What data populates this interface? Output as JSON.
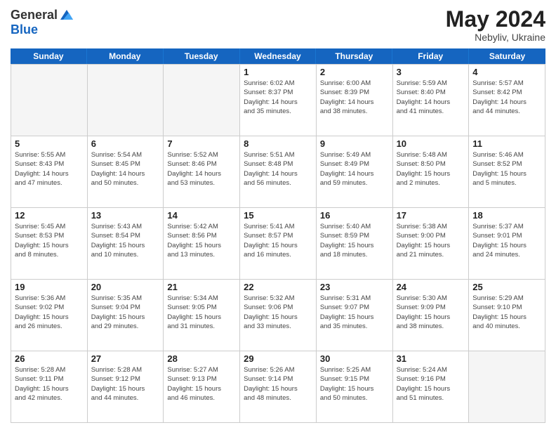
{
  "header": {
    "logo_general": "General",
    "logo_blue": "Blue",
    "month_year": "May 2024",
    "location": "Nebyliv, Ukraine"
  },
  "weekdays": [
    "Sunday",
    "Monday",
    "Tuesday",
    "Wednesday",
    "Thursday",
    "Friday",
    "Saturday"
  ],
  "weeks": [
    [
      {
        "day": "",
        "lines": [],
        "empty": true
      },
      {
        "day": "",
        "lines": [],
        "empty": true
      },
      {
        "day": "",
        "lines": [],
        "empty": true
      },
      {
        "day": "1",
        "lines": [
          "Sunrise: 6:02 AM",
          "Sunset: 8:37 PM",
          "Daylight: 14 hours",
          "and 35 minutes."
        ],
        "empty": false
      },
      {
        "day": "2",
        "lines": [
          "Sunrise: 6:00 AM",
          "Sunset: 8:39 PM",
          "Daylight: 14 hours",
          "and 38 minutes."
        ],
        "empty": false
      },
      {
        "day": "3",
        "lines": [
          "Sunrise: 5:59 AM",
          "Sunset: 8:40 PM",
          "Daylight: 14 hours",
          "and 41 minutes."
        ],
        "empty": false
      },
      {
        "day": "4",
        "lines": [
          "Sunrise: 5:57 AM",
          "Sunset: 8:42 PM",
          "Daylight: 14 hours",
          "and 44 minutes."
        ],
        "empty": false
      }
    ],
    [
      {
        "day": "5",
        "lines": [
          "Sunrise: 5:55 AM",
          "Sunset: 8:43 PM",
          "Daylight: 14 hours",
          "and 47 minutes."
        ],
        "empty": false
      },
      {
        "day": "6",
        "lines": [
          "Sunrise: 5:54 AM",
          "Sunset: 8:45 PM",
          "Daylight: 14 hours",
          "and 50 minutes."
        ],
        "empty": false
      },
      {
        "day": "7",
        "lines": [
          "Sunrise: 5:52 AM",
          "Sunset: 8:46 PM",
          "Daylight: 14 hours",
          "and 53 minutes."
        ],
        "empty": false
      },
      {
        "day": "8",
        "lines": [
          "Sunrise: 5:51 AM",
          "Sunset: 8:48 PM",
          "Daylight: 14 hours",
          "and 56 minutes."
        ],
        "empty": false
      },
      {
        "day": "9",
        "lines": [
          "Sunrise: 5:49 AM",
          "Sunset: 8:49 PM",
          "Daylight: 14 hours",
          "and 59 minutes."
        ],
        "empty": false
      },
      {
        "day": "10",
        "lines": [
          "Sunrise: 5:48 AM",
          "Sunset: 8:50 PM",
          "Daylight: 15 hours",
          "and 2 minutes."
        ],
        "empty": false
      },
      {
        "day": "11",
        "lines": [
          "Sunrise: 5:46 AM",
          "Sunset: 8:52 PM",
          "Daylight: 15 hours",
          "and 5 minutes."
        ],
        "empty": false
      }
    ],
    [
      {
        "day": "12",
        "lines": [
          "Sunrise: 5:45 AM",
          "Sunset: 8:53 PM",
          "Daylight: 15 hours",
          "and 8 minutes."
        ],
        "empty": false
      },
      {
        "day": "13",
        "lines": [
          "Sunrise: 5:43 AM",
          "Sunset: 8:54 PM",
          "Daylight: 15 hours",
          "and 10 minutes."
        ],
        "empty": false
      },
      {
        "day": "14",
        "lines": [
          "Sunrise: 5:42 AM",
          "Sunset: 8:56 PM",
          "Daylight: 15 hours",
          "and 13 minutes."
        ],
        "empty": false
      },
      {
        "day": "15",
        "lines": [
          "Sunrise: 5:41 AM",
          "Sunset: 8:57 PM",
          "Daylight: 15 hours",
          "and 16 minutes."
        ],
        "empty": false
      },
      {
        "day": "16",
        "lines": [
          "Sunrise: 5:40 AM",
          "Sunset: 8:59 PM",
          "Daylight: 15 hours",
          "and 18 minutes."
        ],
        "empty": false
      },
      {
        "day": "17",
        "lines": [
          "Sunrise: 5:38 AM",
          "Sunset: 9:00 PM",
          "Daylight: 15 hours",
          "and 21 minutes."
        ],
        "empty": false
      },
      {
        "day": "18",
        "lines": [
          "Sunrise: 5:37 AM",
          "Sunset: 9:01 PM",
          "Daylight: 15 hours",
          "and 24 minutes."
        ],
        "empty": false
      }
    ],
    [
      {
        "day": "19",
        "lines": [
          "Sunrise: 5:36 AM",
          "Sunset: 9:02 PM",
          "Daylight: 15 hours",
          "and 26 minutes."
        ],
        "empty": false
      },
      {
        "day": "20",
        "lines": [
          "Sunrise: 5:35 AM",
          "Sunset: 9:04 PM",
          "Daylight: 15 hours",
          "and 29 minutes."
        ],
        "empty": false
      },
      {
        "day": "21",
        "lines": [
          "Sunrise: 5:34 AM",
          "Sunset: 9:05 PM",
          "Daylight: 15 hours",
          "and 31 minutes."
        ],
        "empty": false
      },
      {
        "day": "22",
        "lines": [
          "Sunrise: 5:32 AM",
          "Sunset: 9:06 PM",
          "Daylight: 15 hours",
          "and 33 minutes."
        ],
        "empty": false
      },
      {
        "day": "23",
        "lines": [
          "Sunrise: 5:31 AM",
          "Sunset: 9:07 PM",
          "Daylight: 15 hours",
          "and 35 minutes."
        ],
        "empty": false
      },
      {
        "day": "24",
        "lines": [
          "Sunrise: 5:30 AM",
          "Sunset: 9:09 PM",
          "Daylight: 15 hours",
          "and 38 minutes."
        ],
        "empty": false
      },
      {
        "day": "25",
        "lines": [
          "Sunrise: 5:29 AM",
          "Sunset: 9:10 PM",
          "Daylight: 15 hours",
          "and 40 minutes."
        ],
        "empty": false
      }
    ],
    [
      {
        "day": "26",
        "lines": [
          "Sunrise: 5:28 AM",
          "Sunset: 9:11 PM",
          "Daylight: 15 hours",
          "and 42 minutes."
        ],
        "empty": false
      },
      {
        "day": "27",
        "lines": [
          "Sunrise: 5:28 AM",
          "Sunset: 9:12 PM",
          "Daylight: 15 hours",
          "and 44 minutes."
        ],
        "empty": false
      },
      {
        "day": "28",
        "lines": [
          "Sunrise: 5:27 AM",
          "Sunset: 9:13 PM",
          "Daylight: 15 hours",
          "and 46 minutes."
        ],
        "empty": false
      },
      {
        "day": "29",
        "lines": [
          "Sunrise: 5:26 AM",
          "Sunset: 9:14 PM",
          "Daylight: 15 hours",
          "and 48 minutes."
        ],
        "empty": false
      },
      {
        "day": "30",
        "lines": [
          "Sunrise: 5:25 AM",
          "Sunset: 9:15 PM",
          "Daylight: 15 hours",
          "and 50 minutes."
        ],
        "empty": false
      },
      {
        "day": "31",
        "lines": [
          "Sunrise: 5:24 AM",
          "Sunset: 9:16 PM",
          "Daylight: 15 hours",
          "and 51 minutes."
        ],
        "empty": false
      },
      {
        "day": "",
        "lines": [],
        "empty": true
      }
    ]
  ]
}
